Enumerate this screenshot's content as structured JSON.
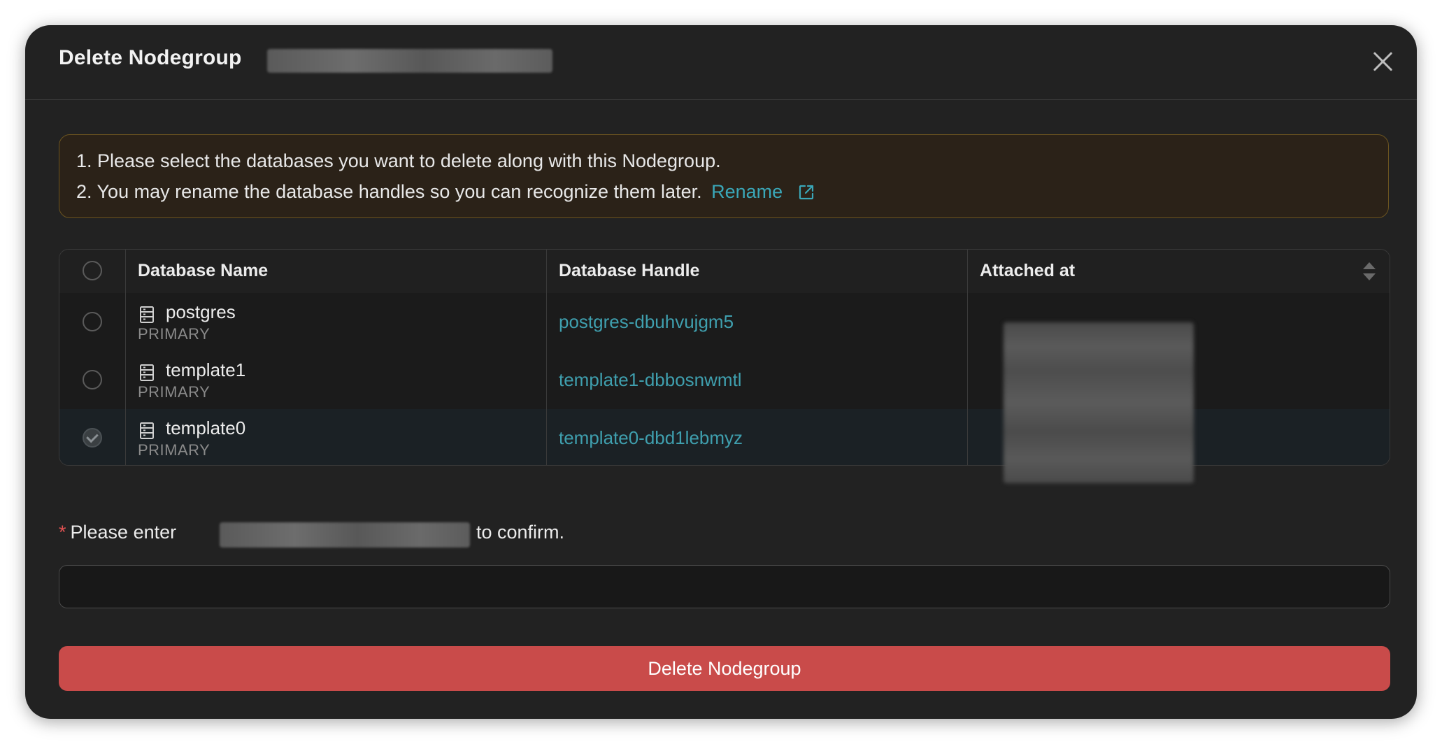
{
  "modal": {
    "title": "Delete Nodegroup",
    "close_icon": "close-icon"
  },
  "notice": {
    "line1": "1. Please select the databases you want to delete along with this Nodegroup.",
    "line2": "2. You may rename the database handles so you can recognize them later.",
    "rename_label": "Rename",
    "rename_icon": "external-link-icon"
  },
  "table": {
    "columns": [
      "Database Name",
      "Database Handle",
      "Attached at"
    ],
    "rows": [
      {
        "name": "postgres",
        "role": "PRIMARY",
        "handle": "postgres-dbuhvujgm5",
        "checked": false
      },
      {
        "name": "template1",
        "role": "PRIMARY",
        "handle": "template1-dbbosnwmtl",
        "checked": false
      },
      {
        "name": "template0",
        "role": "PRIMARY",
        "handle": "template0-dbd1lebmyz",
        "checked": true
      }
    ]
  },
  "confirm": {
    "required_mark": "*",
    "prefix": "Please enter",
    "suffix": "to confirm.",
    "value": ""
  },
  "actions": {
    "delete_label": "Delete Nodegroup"
  },
  "colors": {
    "accent_link": "#3f9fae",
    "danger": "#c94b4a",
    "notice_border": "#6b5420"
  }
}
